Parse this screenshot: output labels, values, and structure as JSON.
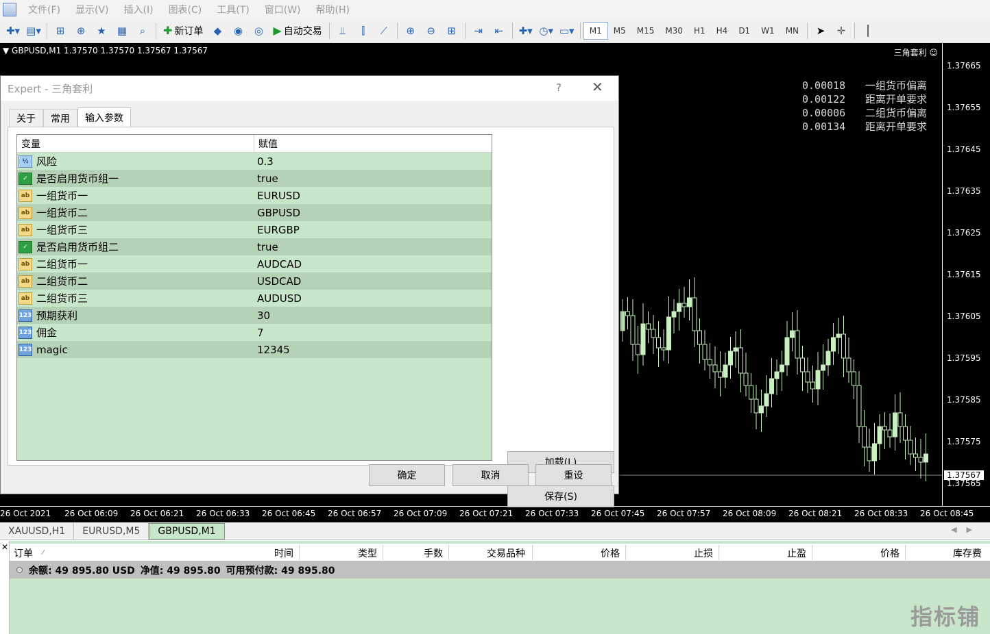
{
  "menubar": {
    "items": [
      "文件(F)",
      "显示(V)",
      "插入(I)",
      "图表(C)",
      "工具(T)",
      "窗口(W)",
      "帮助(H)"
    ]
  },
  "toolbar": {
    "new_order_label": "新订单",
    "auto_trade_label": "自动交易",
    "timeframes": [
      "M1",
      "M5",
      "M15",
      "M30",
      "H1",
      "H4",
      "D1",
      "W1",
      "MN"
    ],
    "active_timeframe": "M1"
  },
  "chart": {
    "header": "GBPUSD,M1  1.37570 1.37570 1.37567 1.37567",
    "ea_label": "三角套利 ☺",
    "info": [
      {
        "value": "0.00018",
        "label": "一组货币偏离"
      },
      {
        "value": "0.00122",
        "label": "距离开单要求"
      },
      {
        "value": "0.00006",
        "label": "二组货币偏离"
      },
      {
        "value": "0.00134",
        "label": "距离开单要求"
      }
    ],
    "price_labels": [
      "1.37665",
      "1.37655",
      "1.37645",
      "1.37635",
      "1.37625",
      "1.37615",
      "1.37605",
      "1.37595",
      "1.37585",
      "1.37575",
      "1.37565"
    ],
    "current_price": "1.37567",
    "time_labels": [
      "26 Oct 2021",
      "26 Oct 06:09",
      "26 Oct 06:21",
      "26 Oct 06:33",
      "26 Oct 06:45",
      "26 Oct 06:57",
      "26 Oct 07:09",
      "26 Oct 07:21",
      "26 Oct 07:33",
      "26 Oct 07:45",
      "26 Oct 07:57",
      "26 Oct 08:09",
      "26 Oct 08:21",
      "26 Oct 08:33",
      "26 Oct 08:45"
    ],
    "colors": {
      "background": "#000000",
      "candle": "#c8f0c0"
    }
  },
  "chart_tabs": {
    "items": [
      "XAUUSD,H1",
      "EURUSD,M5",
      "GBPUSD,M1"
    ],
    "active": "GBPUSD,M1"
  },
  "terminal": {
    "columns": [
      "订单",
      "时间",
      "类型",
      "手数",
      "交易品种",
      "价格",
      "止损",
      "止盈",
      "价格",
      "库存费"
    ],
    "balance_label": "余额: 49 895.80 USD",
    "equity_label": "净值: 49 895.80",
    "free_margin_label": "可用预付款: 49 895.80"
  },
  "watermark": "指标铺",
  "dialog": {
    "title": "Expert - 三角套利",
    "help": "?",
    "close": "✕",
    "tabs": [
      "关于",
      "常用",
      "输入参数"
    ],
    "active_tab": "输入参数",
    "table": {
      "header_variable": "变量",
      "header_value": "赋值",
      "rows": [
        {
          "type": "double",
          "name": "风险",
          "value": "0.3"
        },
        {
          "type": "bool",
          "name": "是否启用货币组一",
          "value": "true"
        },
        {
          "type": "string",
          "name": "一组货币一",
          "value": "EURUSD"
        },
        {
          "type": "string",
          "name": "一组货币二",
          "value": "GBPUSD"
        },
        {
          "type": "string",
          "name": "一组货币三",
          "value": "EURGBP"
        },
        {
          "type": "bool",
          "name": "是否启用货币组二",
          "value": "true"
        },
        {
          "type": "string",
          "name": "二组货币一",
          "value": "AUDCAD"
        },
        {
          "type": "string",
          "name": "二组货币二",
          "value": "USDCAD"
        },
        {
          "type": "string",
          "name": "二组货币三",
          "value": "AUDUSD"
        },
        {
          "type": "int",
          "name": "预期获利",
          "value": "30"
        },
        {
          "type": "int",
          "name": "佣金",
          "value": "7"
        },
        {
          "type": "int",
          "name": "magic",
          "value": "12345"
        }
      ]
    },
    "buttons": {
      "load": "加载(L)",
      "save": "保存(S)",
      "ok": "确定",
      "cancel": "取消",
      "reset": "重设"
    }
  }
}
